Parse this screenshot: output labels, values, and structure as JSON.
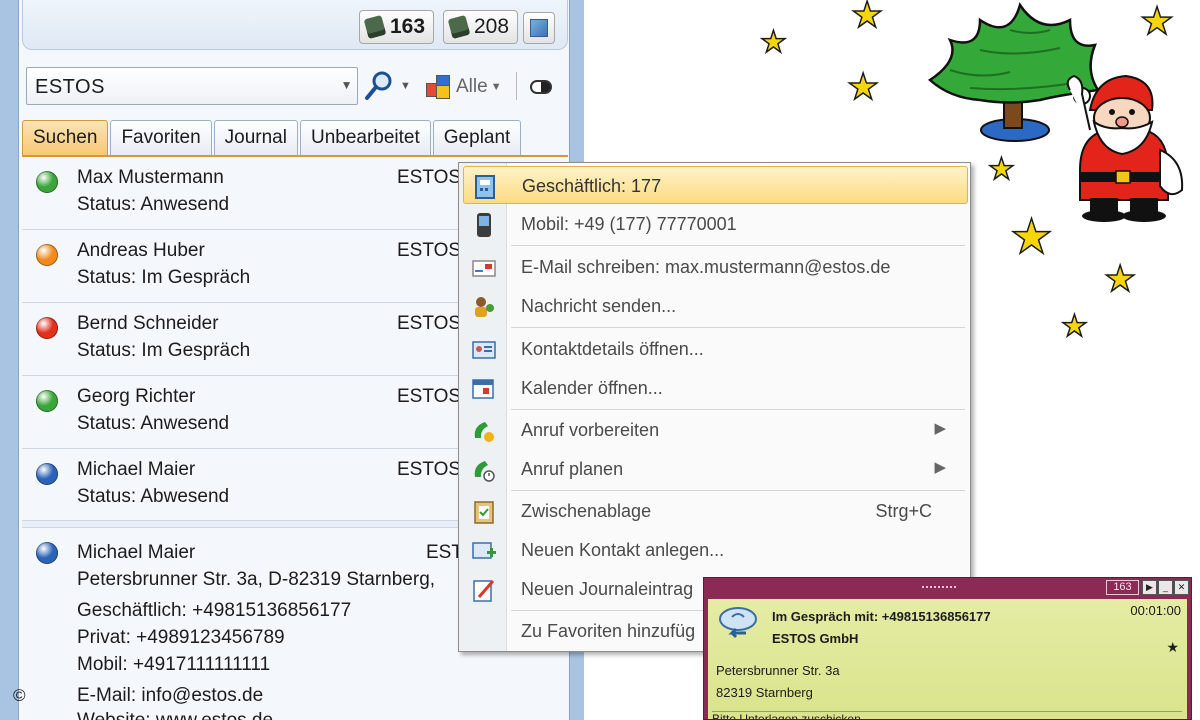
{
  "header": {
    "counter_a": "163",
    "counter_b": "208"
  },
  "search": {
    "value": "ESTOS",
    "filter_label": "Alle"
  },
  "tabs": [
    {
      "label": "Suchen",
      "active": true
    },
    {
      "label": "Favoriten"
    },
    {
      "label": "Journal"
    },
    {
      "label": "Unbearbeitet"
    },
    {
      "label": "Geplant"
    }
  ],
  "contacts": [
    {
      "name": "Max Mustermann",
      "status": "Status: Anwesend",
      "company": "ESTOS",
      "presence_color": "#3aa53a"
    },
    {
      "name": "Andreas Huber",
      "status": "Status: Im Gespräch",
      "company": "ESTOS",
      "presence_color": "#f08a1e"
    },
    {
      "name": "Bernd Schneider",
      "status": "Status: Im Gespräch",
      "company": "ESTOS",
      "presence_color": "#e0301e"
    },
    {
      "name": "Georg Richter",
      "status": "Status: Anwesend",
      "company": "ESTOS",
      "presence_color": "#3aa53a"
    },
    {
      "name": "Michael Maier",
      "status": "Status: Abwesend",
      "company": "ESTOS",
      "presence_color": "#2c63b8"
    }
  ],
  "details": {
    "name": "Michael Maier",
    "company": "EST",
    "address": "Petersbrunner Str. 3a, D-82319 Starnberg,",
    "business": "Geschäftlich: +49815136856177",
    "private": "Privat: +4989123456789",
    "mobile": "Mobil: +4917111111111",
    "email": "E-Mail: info@estos.de",
    "website": "Website: www.estos.de",
    "presence_color": "#2c63b8"
  },
  "copyright": "©",
  "context_menu": {
    "items": [
      {
        "label": "Geschäftlich: 177",
        "icon": "business-phone-icon",
        "highlighted": true
      },
      {
        "label": "Mobil: +49 (177) 77770001",
        "icon": "mobile-phone-icon"
      },
      {
        "label": "E-Mail schreiben: max.mustermann@estos.de",
        "icon": "email-icon"
      },
      {
        "label": "Nachricht senden...",
        "icon": "chat-icon"
      },
      {
        "label": "Kontaktdetails öffnen...",
        "icon": "contact-card-icon"
      },
      {
        "label": "Kalender öffnen...",
        "icon": "calendar-icon"
      },
      {
        "label": "Anruf vorbereiten",
        "icon": "prepare-call-icon",
        "submenu": true
      },
      {
        "label": "Anruf planen",
        "icon": "schedule-call-icon",
        "submenu": true
      },
      {
        "label": "Zwischenablage",
        "icon": "clipboard-icon",
        "shortcut": "Strg+C"
      },
      {
        "label": "Neuen Kontakt anlegen...",
        "icon": "add-contact-icon"
      },
      {
        "label": "Neuen Journaleintrag",
        "icon": "journal-icon"
      },
      {
        "label": "Zu Favoriten hinzufüg",
        "icon": "favorite-icon"
      }
    ]
  },
  "notification": {
    "count": "163",
    "title": "Im Gespräch mit: +49815136856177",
    "company": "ESTOS GmbH",
    "duration": "00:01:00",
    "address_line1": "Petersbrunner Str. 3a",
    "address_line2": "82319 Starnberg",
    "footer": "Bitte Unterlagen zuschicken",
    "bg_color": "#e2e99b",
    "frame_color": "#8c2a56"
  }
}
